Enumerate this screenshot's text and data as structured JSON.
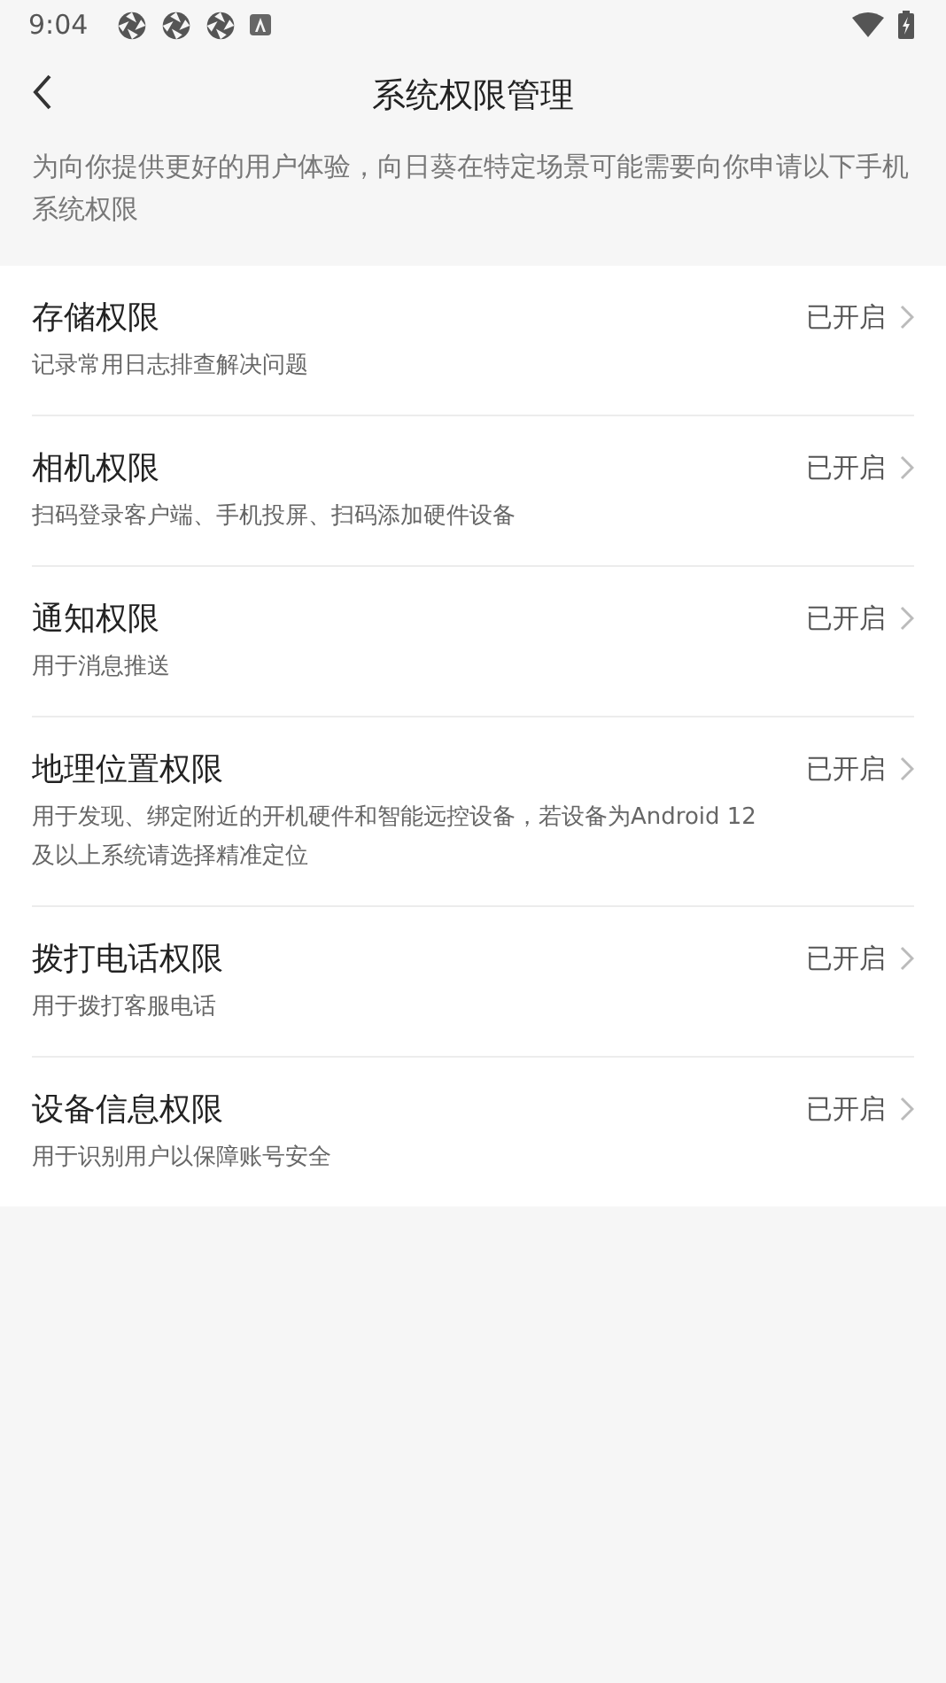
{
  "status_bar": {
    "time": "9:04"
  },
  "header": {
    "title": "系统权限管理"
  },
  "intro": "为向你提供更好的用户体验，向日葵在特定场景可能需要向你申请以下手机系统权限",
  "permissions": [
    {
      "name": "存储权限",
      "description": "记录常用日志排查解决问题",
      "status": "已开启"
    },
    {
      "name": "相机权限",
      "description": "扫码登录客户端、手机投屏、扫码添加硬件设备",
      "status": "已开启"
    },
    {
      "name": "通知权限",
      "description": "用于消息推送",
      "status": "已开启"
    },
    {
      "name": "地理位置权限",
      "description": "用于发现、绑定附近的开机硬件和智能远控设备，若设备为Android 12及以上系统请选择精准定位",
      "status": "已开启"
    },
    {
      "name": "拨打电话权限",
      "description": "用于拨打客服电话",
      "status": "已开启"
    },
    {
      "name": "设备信息权限",
      "description": "用于识别用户以保障账号安全",
      "status": "已开启"
    }
  ]
}
